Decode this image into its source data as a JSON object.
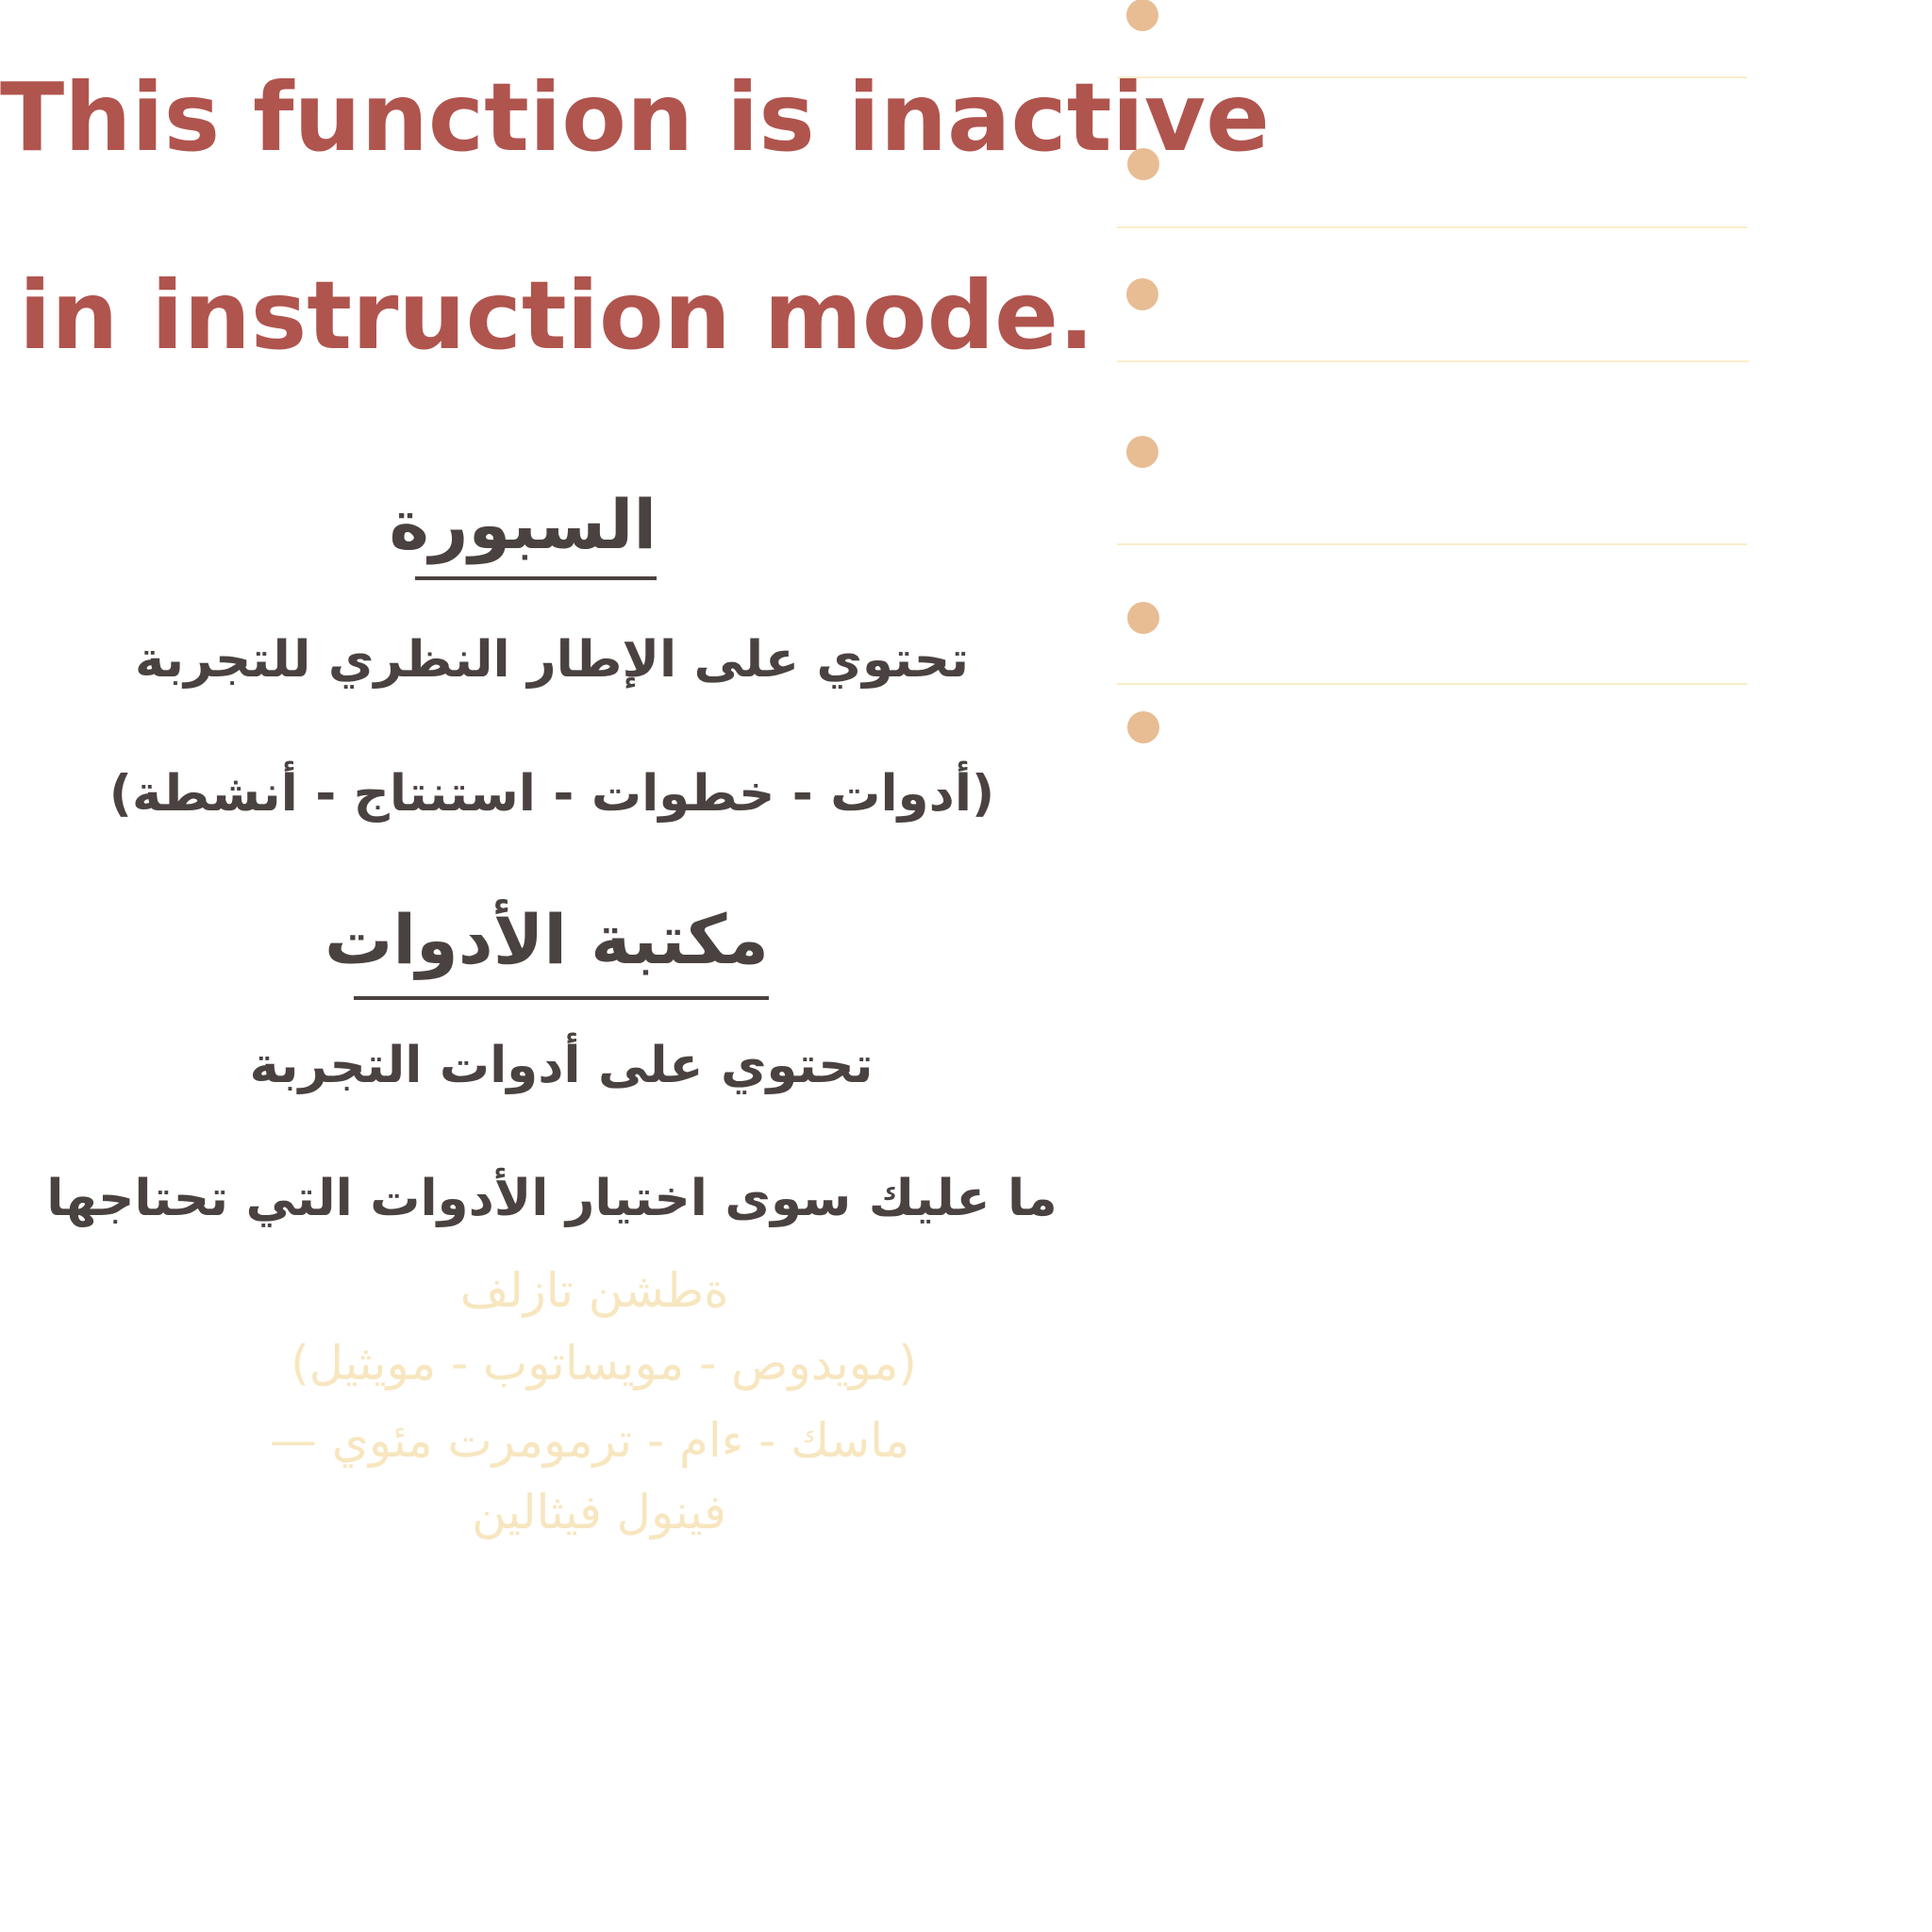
{
  "notice": {
    "line1": "This function is inactive",
    "line2": "in instruction mode."
  },
  "sections": [
    {
      "heading": "السبورة",
      "lines": [
        "تحتوي على الإطار النظري للتجربة",
        "(أدوات - خطوات - استنتاج - أنشطة)"
      ]
    },
    {
      "heading": "مكتبة الأدوات",
      "lines": [
        "تحتوي على أدوات التجربة",
        "ما عليك سوى اختيار الأدوات التي تحتاجها"
      ]
    }
  ],
  "faded_text": [
    "ةطشن تازلف",
    "(مويدوص - مويساتوب - مويثيل)",
    "ماسك - ءام - ترمومرت مئوي —",
    "فينول فيثالين"
  ],
  "colors": {
    "notice": "#b0544e",
    "text": "#4a4240",
    "faded": "#f7e6bf",
    "bullet": "#e8bd94",
    "rule": "#fbedc9"
  }
}
